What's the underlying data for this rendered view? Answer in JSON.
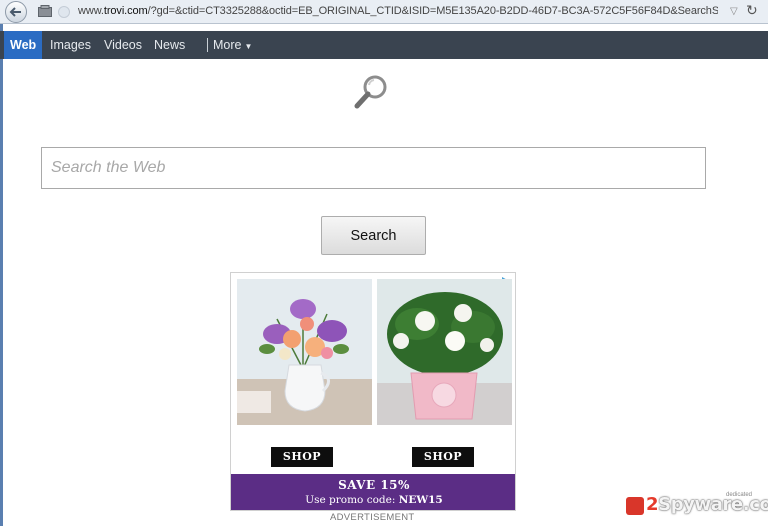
{
  "browser": {
    "url_prefix": "www.",
    "url_domain": "trovi.com",
    "url_rest": "/?gd=&ctid=CT3325288&octid=EB_ORIGINAL_CTID&ISID=M5E135A20-B2DD-46D7-BC3A-572C5F56F84D&SearchS",
    "icons": [
      "back-icon",
      "site-icon",
      "dropdown-icon",
      "reload-icon"
    ]
  },
  "nav": {
    "web": "Web",
    "images": "Images",
    "videos": "Videos",
    "news": "News",
    "more": "More"
  },
  "search": {
    "placeholder": "Search the Web",
    "button": "Search"
  },
  "ad": {
    "shop_left": "SHOP",
    "shop_right": "SHOP",
    "promo_title": "SAVE 15%",
    "promo_text": "Use promo code: ",
    "promo_code": "NEW15",
    "label": "ADVERTISEMENT"
  },
  "watermark": {
    "num": "2",
    "text": "Spyware.com",
    "tag": "dedicated"
  },
  "colors": {
    "nav_bg": "#3a4450",
    "nav_active": "#2b6cc3",
    "promo_bg": "#5b2d85"
  }
}
